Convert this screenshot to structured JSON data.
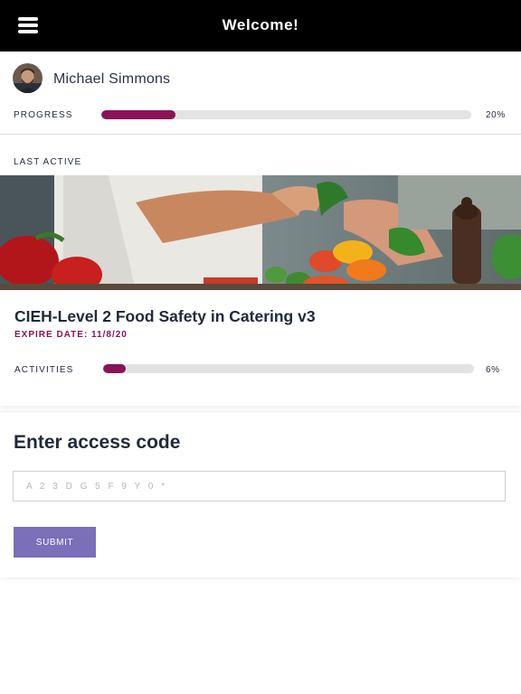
{
  "header": {
    "title": "Welcome!",
    "menu_icon": "hamburger-menu-icon"
  },
  "profile": {
    "name": "Michael Simmons",
    "avatar": "avatar-photo",
    "progress_label": "PROGRESS",
    "progress_percent": 20,
    "progress_text": "20%"
  },
  "last_active": {
    "label": "LAST ACTIVE",
    "image": "food-preparation-photo",
    "course": {
      "title": "CIEH-Level 2 Food Safety in Catering v3",
      "expire": "EXPIRE DATE: 11/8/20",
      "activities_label": "ACTIVITIES",
      "activities_percent": 6,
      "activities_text": "6%"
    }
  },
  "access_code": {
    "title": "Enter access code",
    "placeholder": "A 2 3 D G 5 F 9 Y 0 *",
    "value": "",
    "submit_label": "SUBMIT"
  },
  "colors": {
    "header_bg": "#000000",
    "progress_fill": "#8a1356",
    "track": "#e3e3e3",
    "accent_text": "#8a1356",
    "submit_bg": "#7a6fb8"
  }
}
